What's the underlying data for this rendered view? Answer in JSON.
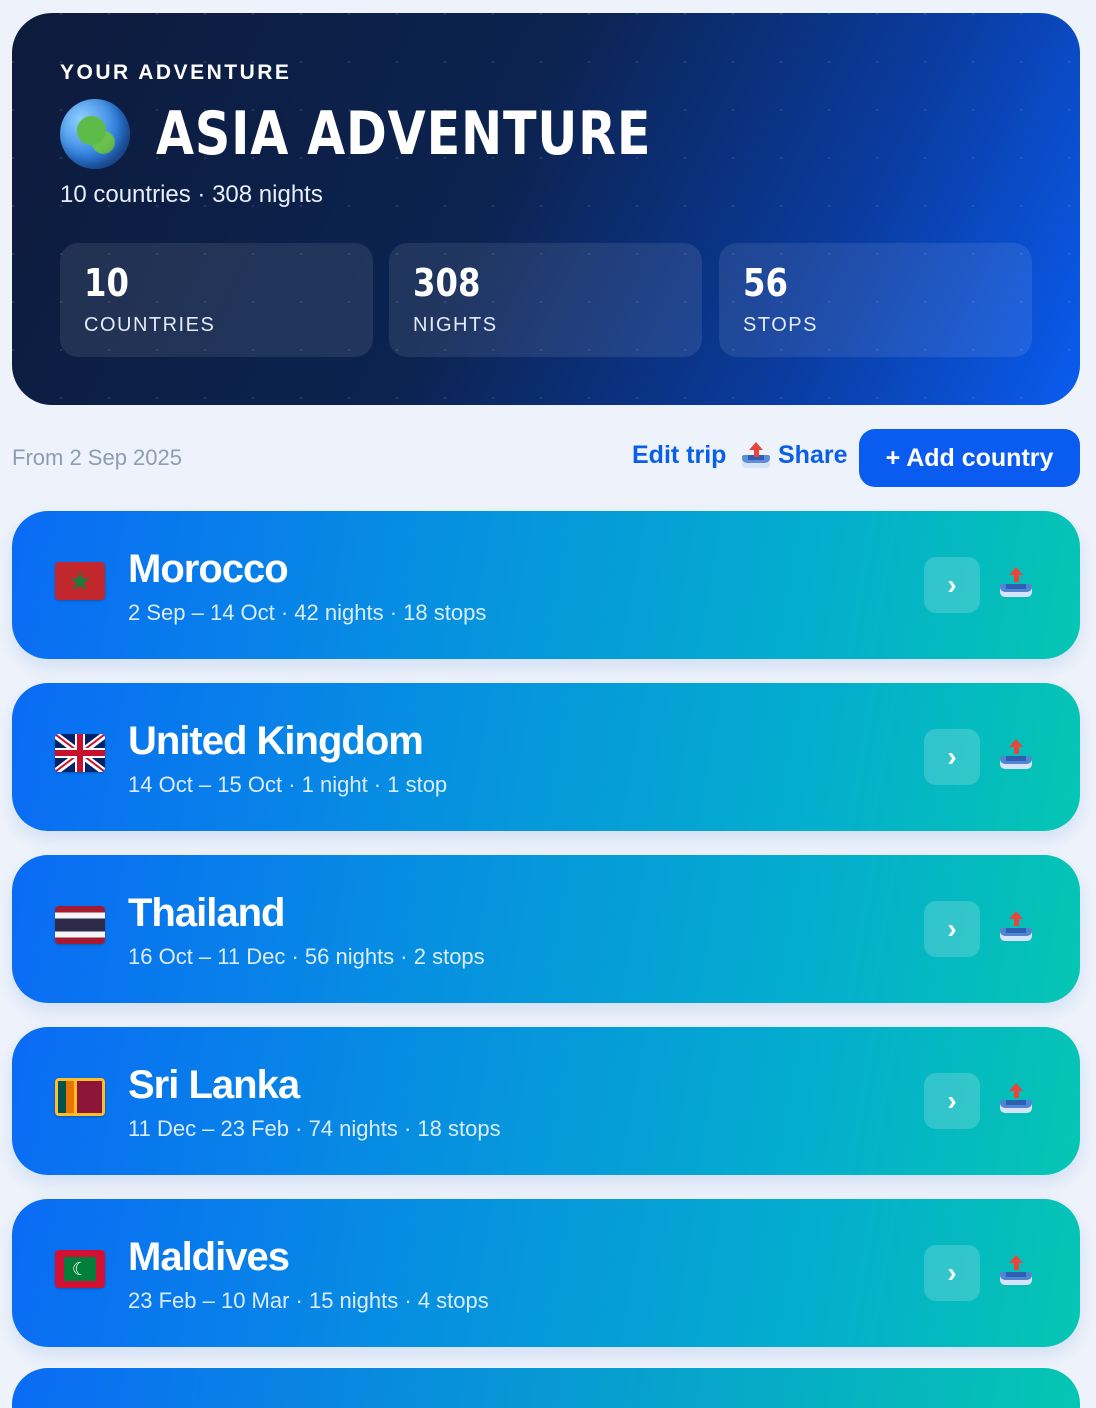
{
  "hero": {
    "eyebrow": "YOUR ADVENTURE",
    "title": "ASIA ADVENTURE",
    "subtitle": "10 countries · 308 nights",
    "stats": [
      {
        "value": "10",
        "label": "COUNTRIES"
      },
      {
        "value": "308",
        "label": "NIGHTS"
      },
      {
        "value": "56",
        "label": "STOPS"
      }
    ]
  },
  "toolbar": {
    "from_label": "From 2 Sep 2025",
    "edit_label": "Edit trip",
    "share_label": "Share",
    "add_label": "+ Add country"
  },
  "countries": [
    {
      "name": "Morocco",
      "meta": "2 Sep – 14 Oct · 42 nights · 18 stops",
      "flag": "morocco-flag-icon"
    },
    {
      "name": "United Kingdom",
      "meta": "14 Oct – 15 Oct · 1 night · 1 stop",
      "flag": "uk-flag-icon"
    },
    {
      "name": "Thailand",
      "meta": "16 Oct – 11 Dec · 56 nights · 2 stops",
      "flag": "thailand-flag-icon"
    },
    {
      "name": "Sri Lanka",
      "meta": "11 Dec – 23 Feb · 74 nights · 18 stops",
      "flag": "sri-lanka-flag-icon"
    },
    {
      "name": "Maldives",
      "meta": "23 Feb – 10 Mar · 15 nights · 4 stops",
      "flag": "maldives-flag-icon"
    }
  ],
  "icons": {
    "chevron": "›"
  },
  "colors": {
    "accent": "#0a5cf0",
    "card_start": "#0a6bf5",
    "card_end": "#05c6b3",
    "hero_bg": "#0d1b3c"
  }
}
